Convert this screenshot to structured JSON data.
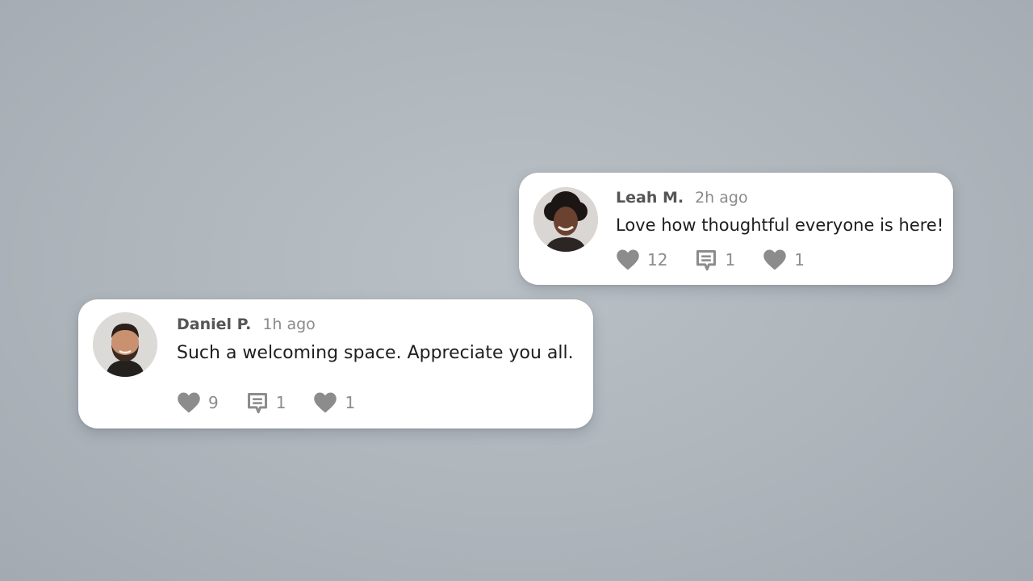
{
  "comments": [
    {
      "author": "Leah M.",
      "time": "2h ago",
      "text": "Love how thoughtful everyone is here!",
      "avatar_icon": "avatar-woman-curly-hair",
      "likes": "12",
      "replies": "1",
      "hearts": "1"
    },
    {
      "author": "Daniel P.",
      "time": "1h ago",
      "text": "Such a welcoming space. Appreciate you all.",
      "avatar_icon": "avatar-man-beard",
      "likes": "9",
      "replies": "1",
      "hearts": "1"
    }
  ],
  "icons": {
    "like": "heart-icon",
    "reply": "comment-icon",
    "react": "heart-icon"
  },
  "colors": {
    "background": "#b3bac0",
    "card": "#ffffff",
    "icon": "#8c8c8c",
    "author": "#555555",
    "time": "#8a8a8a",
    "text": "#1e1e1e"
  }
}
